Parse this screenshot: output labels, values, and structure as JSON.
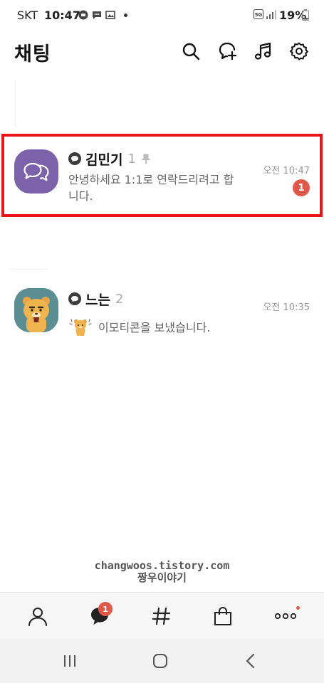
{
  "status_bar": {
    "carrier": "SKT",
    "time": "10:47",
    "battery": "19%",
    "network": "5G",
    "icons": [
      "talk-icon",
      "message-icon",
      "gallery-icon",
      "signal-icon",
      "battery-icon"
    ]
  },
  "header": {
    "title": "채팅",
    "icons": [
      "search-icon",
      "new-chat-icon",
      "music-icon",
      "settings-icon"
    ]
  },
  "chats": [
    {
      "name": "김민기",
      "member_count": "1",
      "pinned": true,
      "preview": "안녕하세요 1:1로 연락드리려고 합니다.",
      "time": "오전 10:47",
      "unread": "1",
      "highlighted": true,
      "avatar_color": "#7b62aa"
    },
    {
      "name": "느는",
      "member_count": "2",
      "pinned": false,
      "preview": "이모티콘을 보냈습니다.",
      "time": "오전 10:35",
      "unread": "",
      "avatar_color": "#5a8e92"
    }
  ],
  "watermark": {
    "line1": "changwoos.tistory.com",
    "line2": "짱우이야기"
  },
  "tab_bar": {
    "tabs": [
      "friends-tab",
      "chats-tab",
      "openchat-tab",
      "shopping-tab",
      "more-tab"
    ],
    "chats_badge": "1",
    "active_tab": "chats-tab"
  },
  "colors": {
    "highlight_border": "#e8161b",
    "badge": "#e0584a",
    "accent_purple": "#7b62aa"
  }
}
